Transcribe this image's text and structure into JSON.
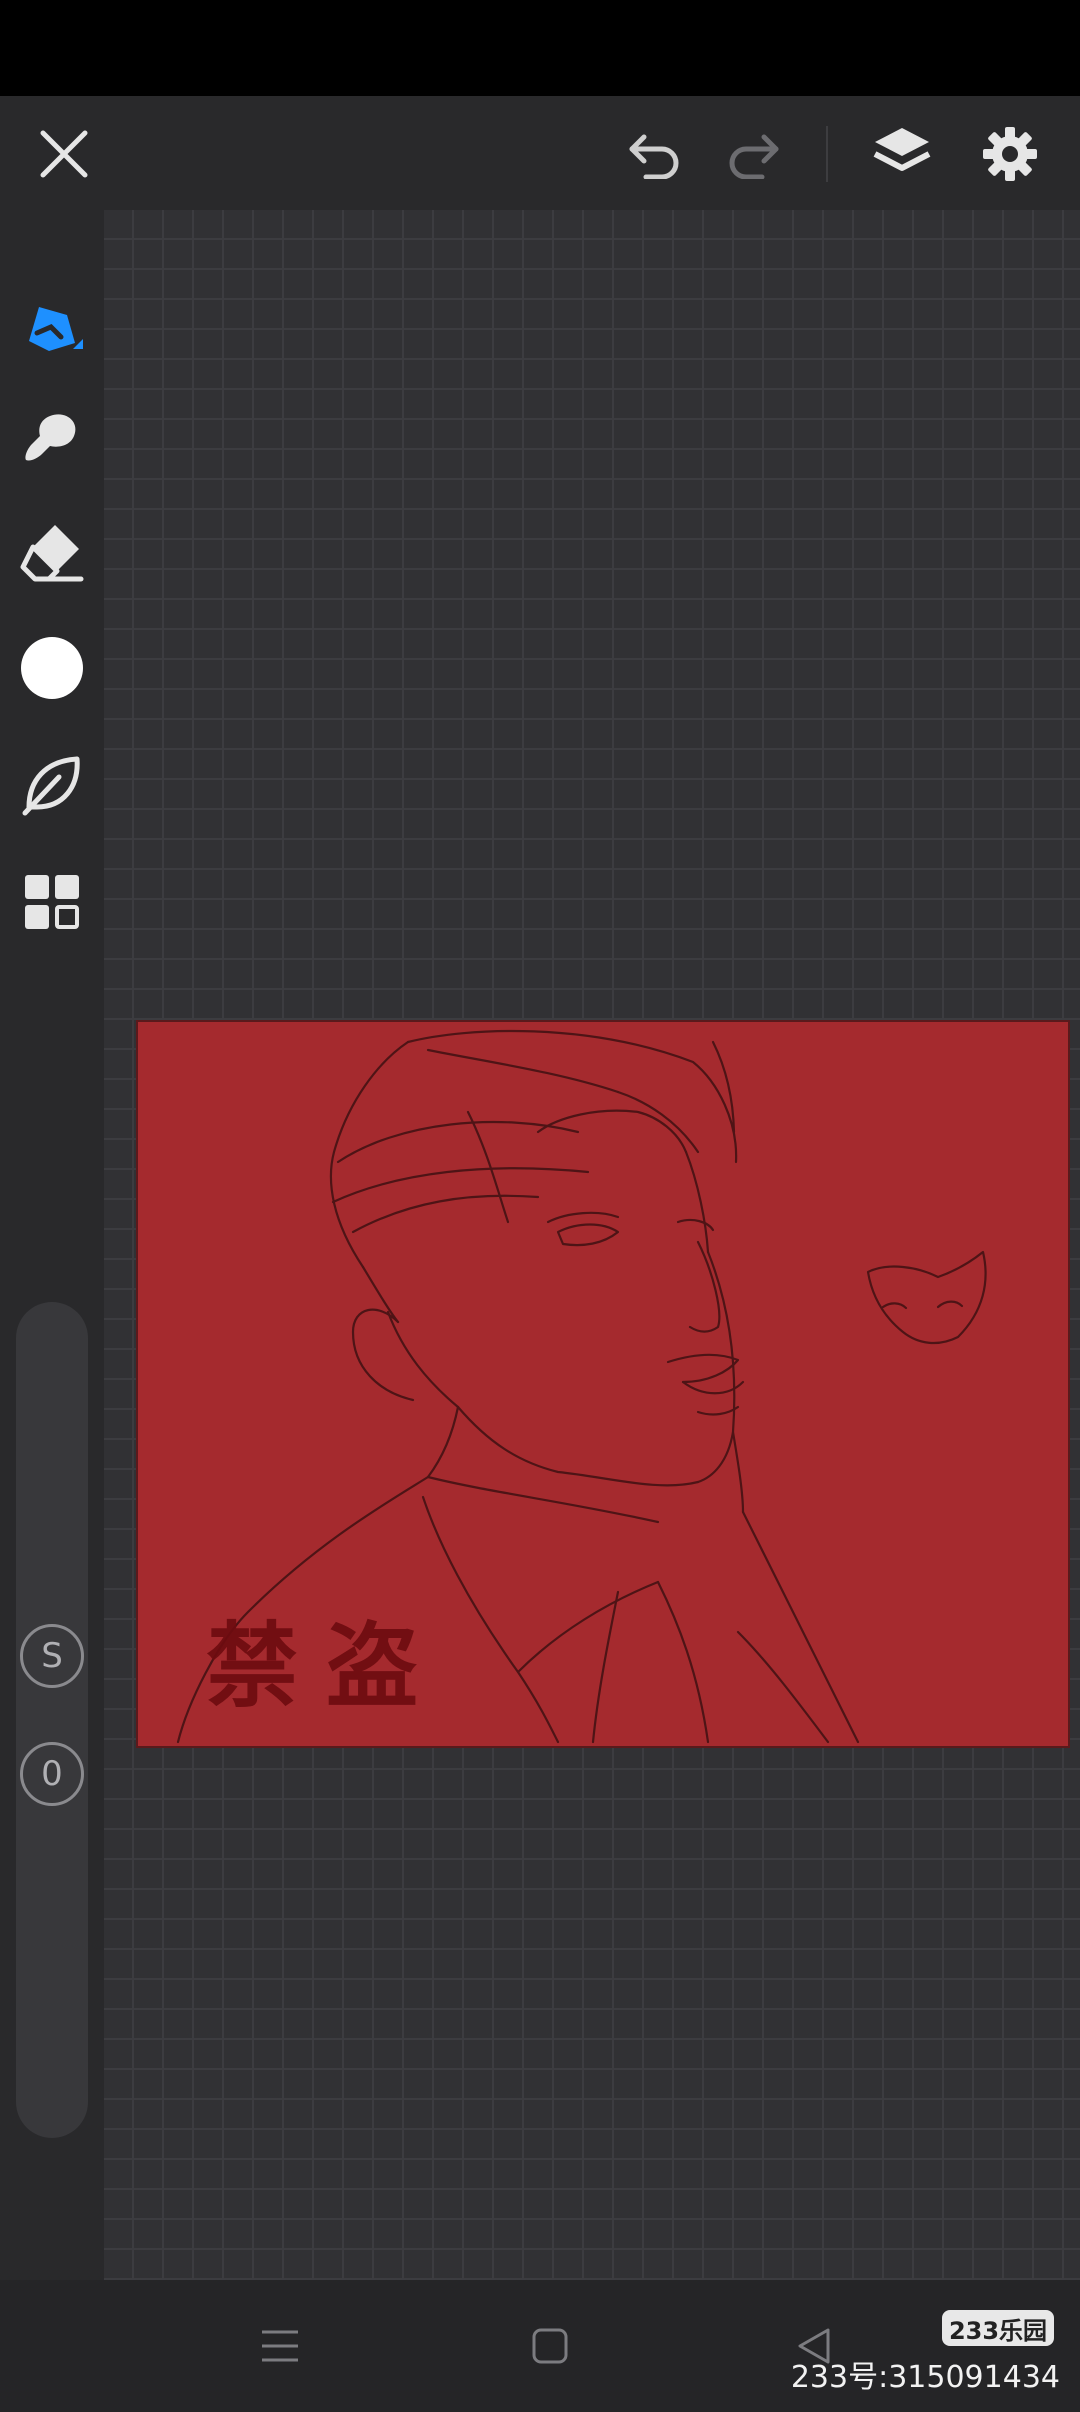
{
  "toolbar": {
    "close": "close-icon",
    "undo": "undo-icon",
    "redo": "redo-icon",
    "layers": "layers-icon",
    "settings": "gear-icon"
  },
  "tools": [
    {
      "name": "pen",
      "icon": "pen-icon",
      "active": true
    },
    {
      "name": "brush",
      "icon": "brush-icon"
    },
    {
      "name": "eraser",
      "icon": "eraser-icon"
    },
    {
      "name": "color",
      "icon": "color-swatch",
      "color": "#ffffff"
    },
    {
      "name": "smudge",
      "icon": "leaf-icon"
    },
    {
      "name": "more",
      "icon": "grid-icon"
    }
  ],
  "sliders": {
    "size_label": "S",
    "opacity_label": "0"
  },
  "artwork": {
    "background_color": "#a52a2e",
    "watermark": "禁盗"
  },
  "navbar": {
    "menu": "menu-icon",
    "home": "home-icon",
    "back": "back-icon"
  },
  "overlay": {
    "logo": "233乐园",
    "user_id": "233号:315091434"
  },
  "colors": {
    "accent": "#1e90ff",
    "toolbar_bg": "#29292b",
    "canvas_bg": "#313134"
  }
}
